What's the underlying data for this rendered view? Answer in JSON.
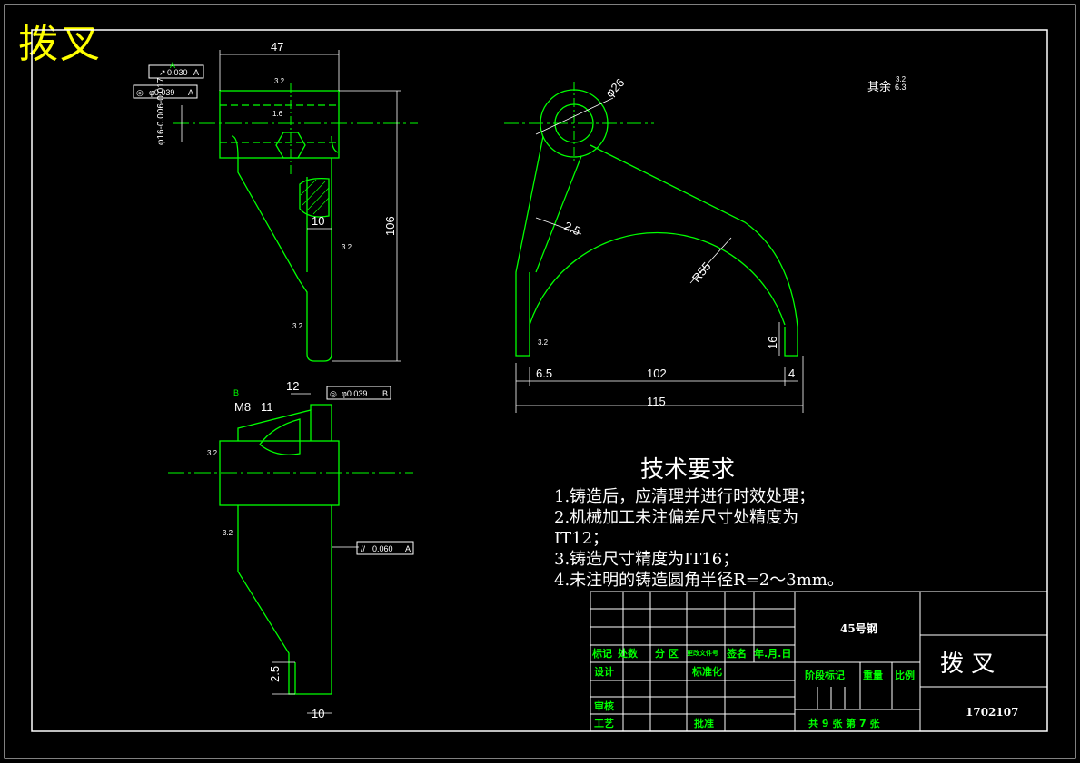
{
  "title": "拨叉",
  "tech_requirements": {
    "heading": "技术要求",
    "lines": [
      "1.铸造后，应清理并进行时效处理；",
      "2.机械加工未注偏差尺寸处精度为",
      "IT12；",
      "3.铸造尺寸精度为IT16；",
      "4.未注明的铸造圆角半径R=2～3mm。"
    ]
  },
  "surface_note": {
    "label": "其余",
    "value": "6.3"
  },
  "dimensions": {
    "d47": "47",
    "d106": "106",
    "d10a": "10",
    "d26": "φ26",
    "d25a": "2.5",
    "r55": "R55",
    "d16": "16",
    "d65": "6.5",
    "d102": "102",
    "d4": "4",
    "d115": "115",
    "d12": "12",
    "m8": "M8",
    "x11": "11",
    "d25b": "2.5",
    "d10b": "10",
    "shaft": "φ16-0.006-0.017"
  },
  "tolerances": {
    "runout1": "0.030",
    "datum_a": "A",
    "conc1": "φ0.039",
    "conc2": "φ0.039",
    "datum_b": "B",
    "parallel": "0.060"
  },
  "roughness": {
    "r1": "3.2",
    "r2": "1.6",
    "r3": "3.2",
    "r4": "3.2",
    "r5": "3.2",
    "r6": "3.2",
    "r7": "3.2",
    "r8": "3.2"
  },
  "title_block": {
    "material": "45号钢",
    "part_name": "拨  叉",
    "drawing_no": "1702107",
    "h_mark": "标记",
    "h_count": "处数",
    "h_zone": "分  区",
    "h_doc": "更改文件号",
    "h_sign": "签名",
    "h_date": "年.月.日",
    "design": "设计",
    "standard": "标准化",
    "stage": "阶段标记",
    "weight": "重量",
    "scale": "比例",
    "review": "审核",
    "process": "工艺",
    "approve": "批准",
    "sheets": "共 9 张   第 7 张"
  },
  "colors": {
    "line": "#00ff00",
    "text": "#ffffff",
    "title": "#ffff00",
    "border": "#ffffff"
  }
}
